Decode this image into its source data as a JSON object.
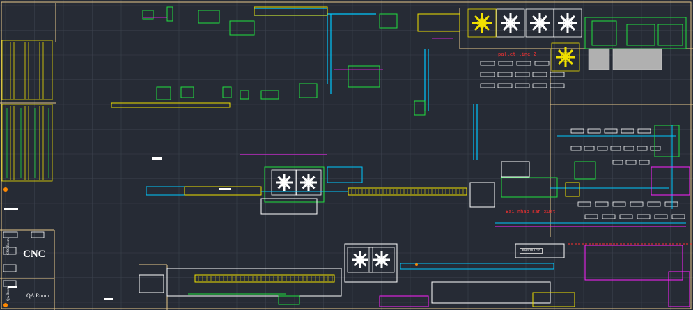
{
  "drawing": {
    "labels": {
      "cnc": "CNC",
      "qa_room": "QA Room",
      "cnc_room_small": "CNC Room",
      "qa_room_small": "QA Room",
      "red_note_top": "pallet line 2",
      "red_note_mid": "Bai nhap san xuat",
      "boxed_note": "WAREHOUSE"
    },
    "colors": {
      "background": "#262b35",
      "grid": "#3c424e",
      "wall": "#e8c98a",
      "cyan": "#00c8ff",
      "yellow": "#f0e000",
      "green": "#20e040",
      "magenta": "#ff20ff",
      "white": "#ffffff",
      "red": "#ff3030"
    }
  }
}
